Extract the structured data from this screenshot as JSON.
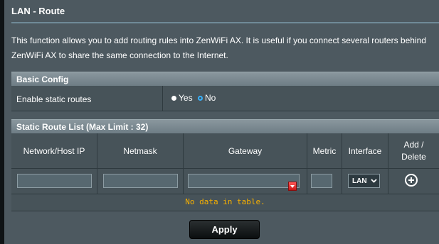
{
  "page": {
    "title": "LAN - Route",
    "description_line1": "This function allows you to add routing rules into ZenWiFi AX. It is useful if you connect several routers behind",
    "description_line2": "ZenWiFi AX to share the same connection to the Internet."
  },
  "basic_config": {
    "header": "Basic Config",
    "static_routes_label": "Enable static routes",
    "options": [
      "Yes",
      "No"
    ],
    "selected": "No"
  },
  "static_route_list": {
    "header": "Static Route List (Max Limit : 32)",
    "columns": [
      "Network/Host IP",
      "Netmask",
      "Gateway",
      "Metric",
      "Interface",
      "Add /",
      "Delete"
    ],
    "inputs": {
      "network_ip": "",
      "netmask": "",
      "gateway": "",
      "metric": "",
      "interface": "LAN"
    },
    "empty_message": "No data in table."
  },
  "actions": {
    "apply_label": "Apply"
  },
  "colors": {
    "background": "#4d5960",
    "section_header": "#7c8a91",
    "empty_message": "#f7b000",
    "radio_selected": "#38b2ff"
  },
  "icons": {
    "add": "add-circle-icon",
    "dropdown": "chevron-down-icon"
  }
}
